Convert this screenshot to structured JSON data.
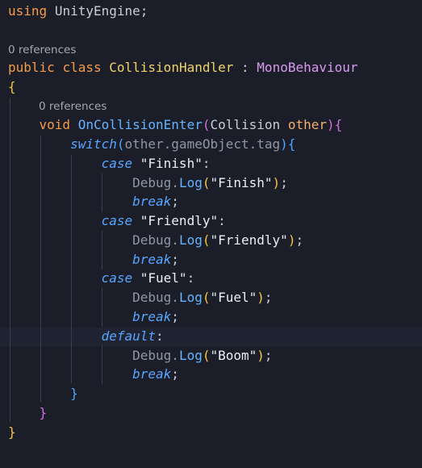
{
  "code": {
    "using_kw": "using",
    "namespace": "UnityEngine",
    "semicolon": ";",
    "codelens_refs": "0 references",
    "public_kw": "public",
    "class_kw": "class",
    "class_name": "CollisionHandler",
    "colon": ":",
    "base_class": "MonoBehaviour",
    "open_brace": "{",
    "close_brace": "}",
    "void_kw": "void",
    "method_name": "OnCollisionEnter",
    "open_paren": "(",
    "close_paren": ")",
    "param_type": "Collision",
    "param_name": "other",
    "switch_kw": "switch",
    "switch_expr": "other.gameObject.tag",
    "case_kw": "case",
    "default_kw": "default",
    "break_kw": "break",
    "debug_class": "Debug",
    "dot": ".",
    "log_method": "Log",
    "case_finish": "\"Finish\"",
    "case_friendly": "\"Friendly\"",
    "case_fuel": "\"Fuel\"",
    "log_boom": "\"Boom\""
  },
  "colors": {
    "background": "#1b1e28",
    "keyword": "#f39c4a",
    "class_name": "#f0d36b",
    "base_type": "#d79bf0",
    "method": "#66b3ff",
    "control_keyword": "#58a6ff",
    "string": "#eaeef9"
  }
}
